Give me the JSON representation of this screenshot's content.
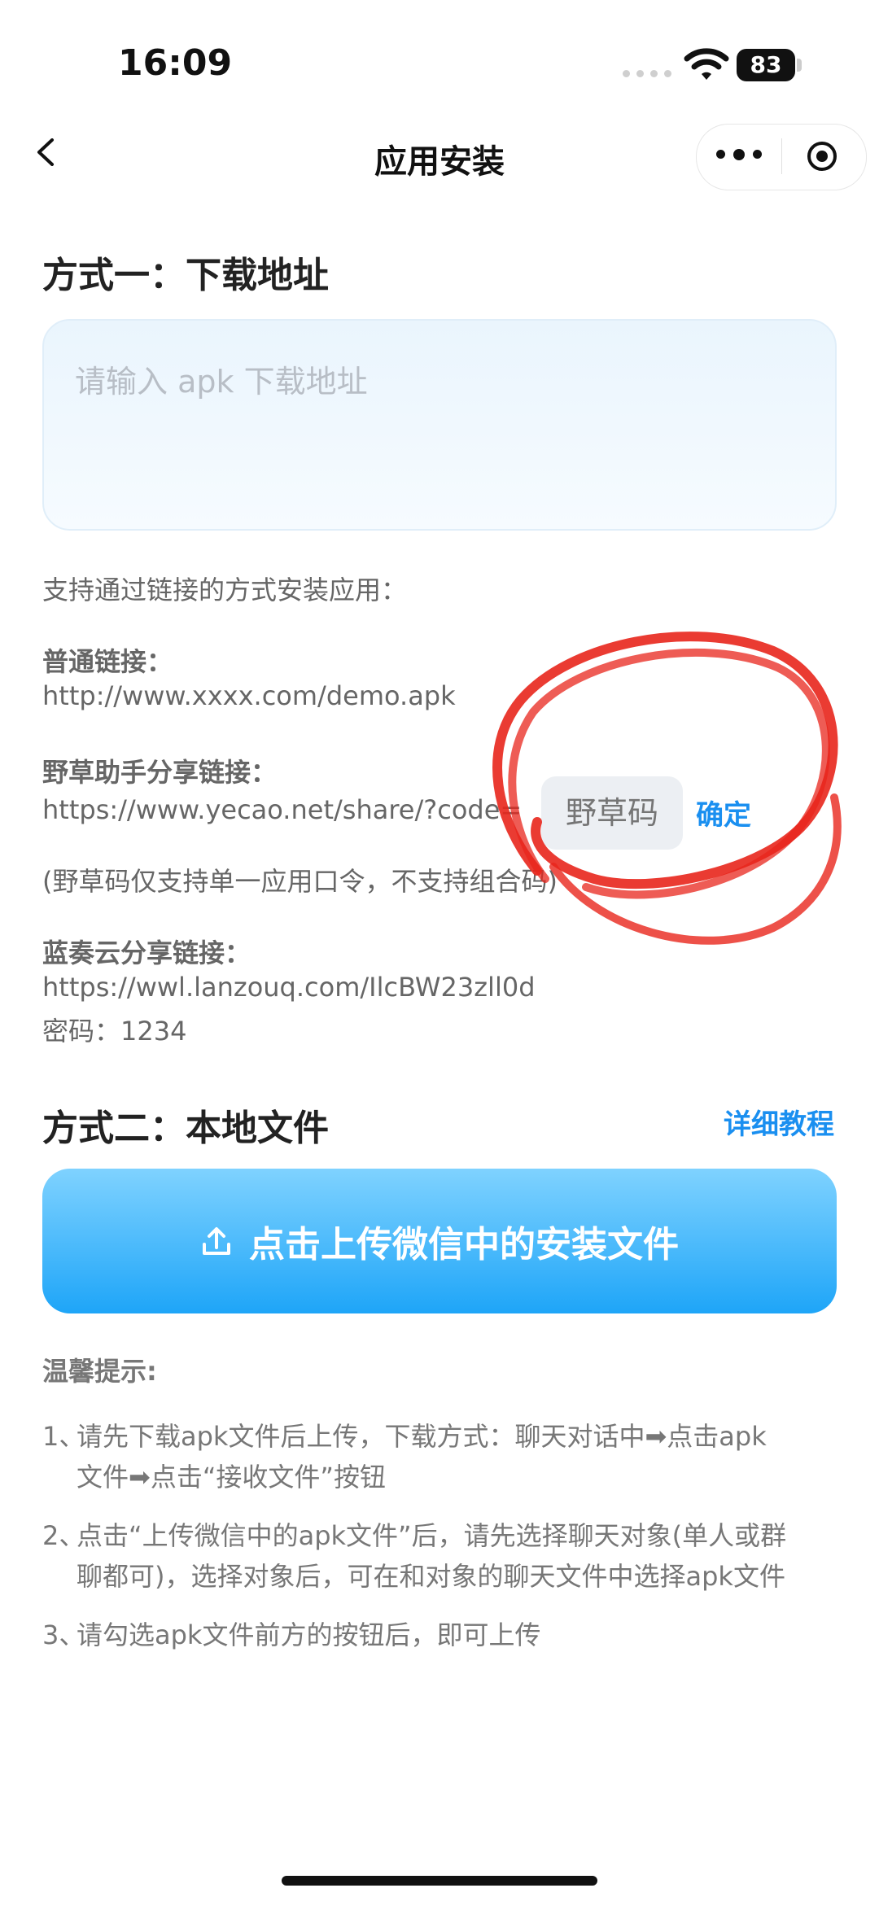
{
  "status": {
    "time": "16:09",
    "battery": "83"
  },
  "nav": {
    "title": "应用安装"
  },
  "section1": {
    "heading": "方式一：下载地址",
    "input_placeholder": "请输入 apk 下载地址",
    "support_text": "支持通过链接的方式安装应用：",
    "normal_label": "普通链接：",
    "normal_example": "http://www.xxxx.com/demo.apk",
    "yecao_label": "野草助手分享链接：",
    "yecao_prefix": "https://www.yecao.net/share/?code=",
    "code_placeholder": "野草码",
    "confirm_label": "确定",
    "yecao_note": "(野草码仅支持单一应用口令，不支持组合码)",
    "lanzou_label": "蓝奏云分享链接：",
    "lanzou_url": "https://wwl.lanzouq.com/IlcBW23zll0d",
    "lanzou_pwd": "密码：1234"
  },
  "section2": {
    "heading": "方式二：本地文件",
    "detail_link": "详细教程",
    "upload_label": "点击上传微信中的安装文件"
  },
  "tips": {
    "title": "温馨提示:",
    "items": [
      {
        "num": "1、",
        "line1": "请先下载apk文件后上传，下载方式：聊天对话中➡点击apk",
        "line2": "文件➡点击“接收文件”按钮"
      },
      {
        "num": "2、",
        "line1": "点击“上传微信中的apk文件”后，请先选择聊天对象(单人或群",
        "line2": "聊都可)，选择对象后，可在和对象的聊天文件中选择apk文件"
      },
      {
        "num": "3、",
        "line1": "请勾选apk文件前方的按钮后，即可上传",
        "line2": ""
      }
    ]
  },
  "colors": {
    "accent": "#1a8ff0",
    "annotation": "#e8261c"
  },
  "icons": [
    "back-arrow-icon",
    "more-icon",
    "target-icon",
    "upload-icon",
    "wifi-icon",
    "battery-icon"
  ]
}
